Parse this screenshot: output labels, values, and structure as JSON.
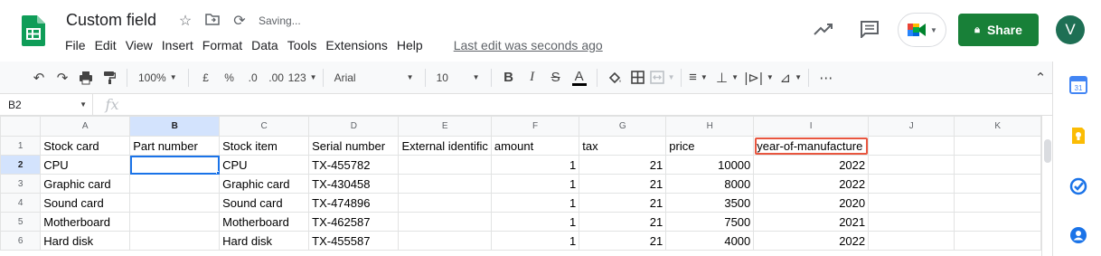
{
  "app": {
    "title": "Custom field",
    "status": "Saving...",
    "last_edit": "Last edit was seconds ago",
    "share_label": "Share",
    "avatar_initial": "V"
  },
  "menu": [
    "File",
    "Edit",
    "View",
    "Insert",
    "Format",
    "Data",
    "Tools",
    "Extensions",
    "Help"
  ],
  "toolbar": {
    "zoom": "100%",
    "currency": "£",
    "percent": "%",
    "dec_decrease": ".0",
    "dec_increase": ".00",
    "number_format": "123",
    "font": "Arial",
    "font_size": "10"
  },
  "formula_bar": {
    "name_box": "B2",
    "fx": "fx",
    "value": ""
  },
  "columns": [
    "A",
    "B",
    "C",
    "D",
    "E",
    "F",
    "G",
    "H",
    "I",
    "J",
    "K"
  ],
  "rows": [
    {
      "n": "1",
      "cells": [
        "Stock card",
        "Part number",
        "Stock item",
        "Serial number",
        "External identific",
        "amount",
        "tax",
        "price",
        "year-of-manufacture",
        "",
        ""
      ]
    },
    {
      "n": "2",
      "cells": [
        "CPU",
        "",
        "CPU",
        "TX-455782",
        "",
        "1",
        "21",
        "10000",
        "2022",
        "",
        ""
      ]
    },
    {
      "n": "3",
      "cells": [
        "Graphic card",
        "",
        "Graphic card",
        "TX-430458",
        "",
        "1",
        "21",
        "8000",
        "2022",
        "",
        ""
      ]
    },
    {
      "n": "4",
      "cells": [
        "Sound card",
        "",
        "Sound card",
        "TX-474896",
        "",
        "1",
        "21",
        "3500",
        "2020",
        "",
        ""
      ]
    },
    {
      "n": "5",
      "cells": [
        "Motherboard",
        "",
        "Motherboard",
        "TX-462587",
        "",
        "1",
        "21",
        "7500",
        "2021",
        "",
        ""
      ]
    },
    {
      "n": "6",
      "cells": [
        "Hard disk",
        "",
        "Hard disk",
        "TX-455587",
        "",
        "1",
        "21",
        "4000",
        "2022",
        "",
        ""
      ]
    }
  ],
  "selected_cell": "B2",
  "highlighted_cell": "I1",
  "colors": {
    "share_bg": "#188038",
    "selection": "#1a73e8",
    "highlight": "#e8563f",
    "avatar": "#1e6f54"
  }
}
